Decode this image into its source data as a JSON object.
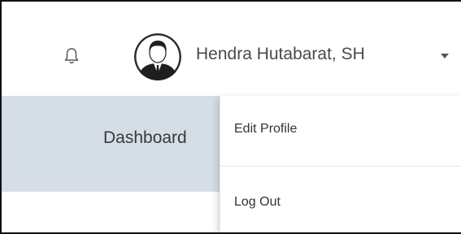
{
  "header": {
    "user_name": "Hendra Hutabarat, SH",
    "icons": {
      "notification": "bell-icon",
      "avatar": "user-avatar",
      "dropdown": "caret-down-icon"
    }
  },
  "subnav": {
    "dashboard_label": "Dashboard",
    "partially_hidden_text": "· · ·"
  },
  "user_menu": {
    "items": [
      {
        "label": "Edit Profile"
      },
      {
        "label": "Log Out"
      }
    ]
  },
  "colors": {
    "subnav_background": "#d5dde6",
    "text": "#4a4a4a",
    "menu_background": "#ffffff"
  }
}
